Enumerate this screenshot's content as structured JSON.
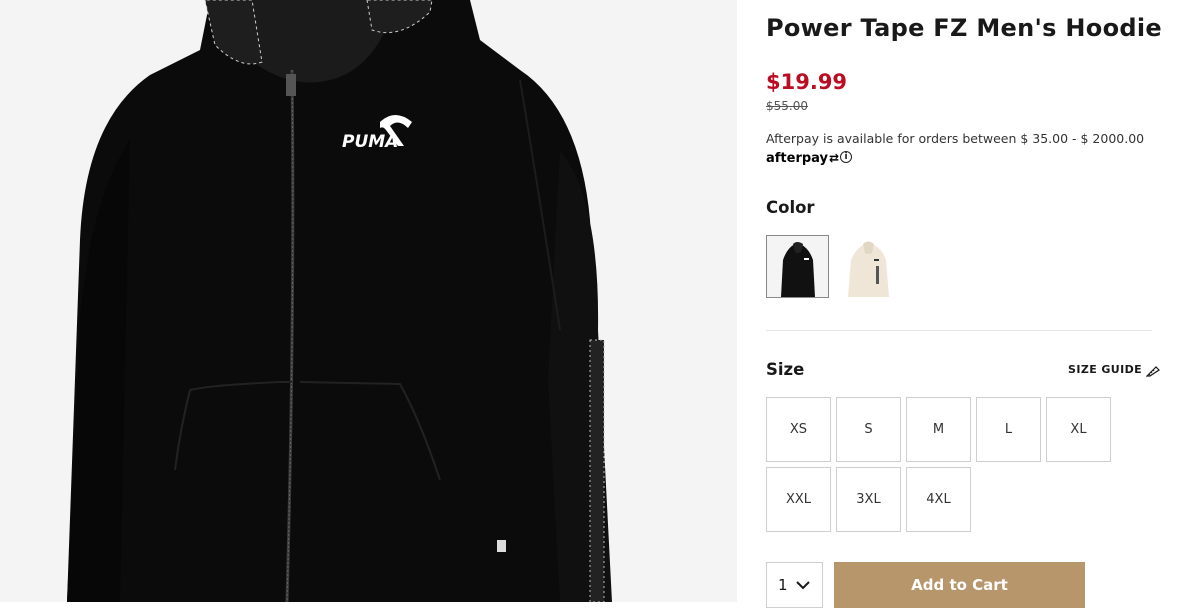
{
  "product": {
    "title": "Power Tape FZ Men's Hoodie",
    "sale_price": "$19.99",
    "original_price": "$55.00",
    "image_alt": "Black full-zip hoodie with PUMA logo",
    "logo_text": "PUMA"
  },
  "afterpay": {
    "text": "Afterpay is available for orders between $ 35.00 - $ 2000.00",
    "logo": "afterpay",
    "info_icon": "info-icon"
  },
  "color": {
    "label": "Color",
    "swatches": [
      {
        "name": "Black",
        "hex": "#111111",
        "selected": true
      },
      {
        "name": "Cream",
        "hex": "#efe6d8",
        "selected": false
      }
    ]
  },
  "size": {
    "label": "Size",
    "guide_label": "SIZE GUIDE",
    "options": [
      "XS",
      "S",
      "M",
      "L",
      "XL",
      "XXL",
      "3XL",
      "4XL"
    ]
  },
  "purchase": {
    "quantity": "1",
    "add_to_cart_label": "Add to Cart"
  },
  "colors": {
    "sale": "#ba0d23",
    "cart_button": "#b7966c",
    "image_bg": "#f4f4f4"
  }
}
